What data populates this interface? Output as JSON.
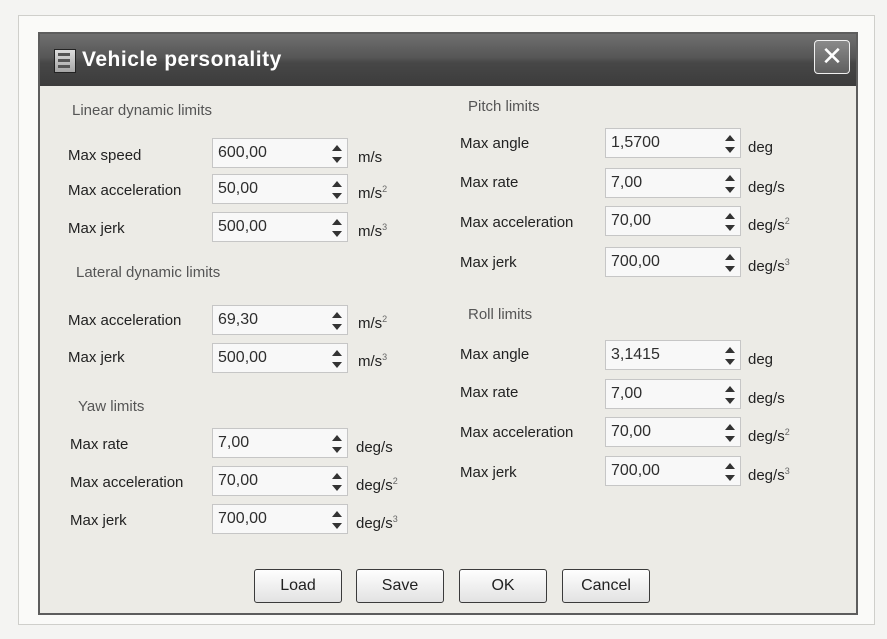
{
  "window": {
    "title": "Vehicle personality",
    "close_glyph": "✕"
  },
  "linear": {
    "group": "Linear dynamic limits",
    "rows": [
      {
        "label": "Max speed",
        "value": "600,00",
        "unit": "m/s",
        "sup": ""
      },
      {
        "label": "Max acceleration",
        "value": "50,00",
        "unit": "m/s",
        "sup": "2"
      },
      {
        "label": "Max jerk",
        "value": "500,00",
        "unit": "m/s",
        "sup": "3"
      }
    ]
  },
  "lateral": {
    "group": "Lateral dynamic limits",
    "rows": [
      {
        "label": "Max acceleration",
        "value": "69,30",
        "unit": "m/s",
        "sup": "2"
      },
      {
        "label": "Max jerk",
        "value": "500,00",
        "unit": "m/s",
        "sup": "3"
      }
    ]
  },
  "yaw": {
    "group": "Yaw limits",
    "rows": [
      {
        "label": "Max rate",
        "value": "7,00",
        "unit": "deg/s",
        "sup": ""
      },
      {
        "label": "Max acceleration",
        "value": "70,00",
        "unit": "deg/s",
        "sup": "2"
      },
      {
        "label": "Max jerk",
        "value": "700,00",
        "unit": "deg/s",
        "sup": "3"
      }
    ]
  },
  "pitch": {
    "group": "Pitch limits",
    "rows": [
      {
        "label": "Max angle",
        "value": "1,5700",
        "unit": "deg",
        "sup": ""
      },
      {
        "label": "Max rate",
        "value": "7,00",
        "unit": "deg/s",
        "sup": ""
      },
      {
        "label": "Max acceleration",
        "value": "70,00",
        "unit": "deg/s",
        "sup": "2"
      },
      {
        "label": "Max jerk",
        "value": "700,00",
        "unit": "deg/s",
        "sup": "3"
      }
    ]
  },
  "roll": {
    "group": "Roll limits",
    "rows": [
      {
        "label": "Max angle",
        "value": "3,1415",
        "unit": "deg",
        "sup": ""
      },
      {
        "label": "Max rate",
        "value": "7,00",
        "unit": "deg/s",
        "sup": ""
      },
      {
        "label": "Max acceleration",
        "value": "70,00",
        "unit": "deg/s",
        "sup": "2"
      },
      {
        "label": "Max jerk",
        "value": "700,00",
        "unit": "deg/s",
        "sup": "3"
      }
    ]
  },
  "buttons": {
    "load": "Load",
    "save": "Save",
    "ok": "OK",
    "cancel": "Cancel"
  }
}
